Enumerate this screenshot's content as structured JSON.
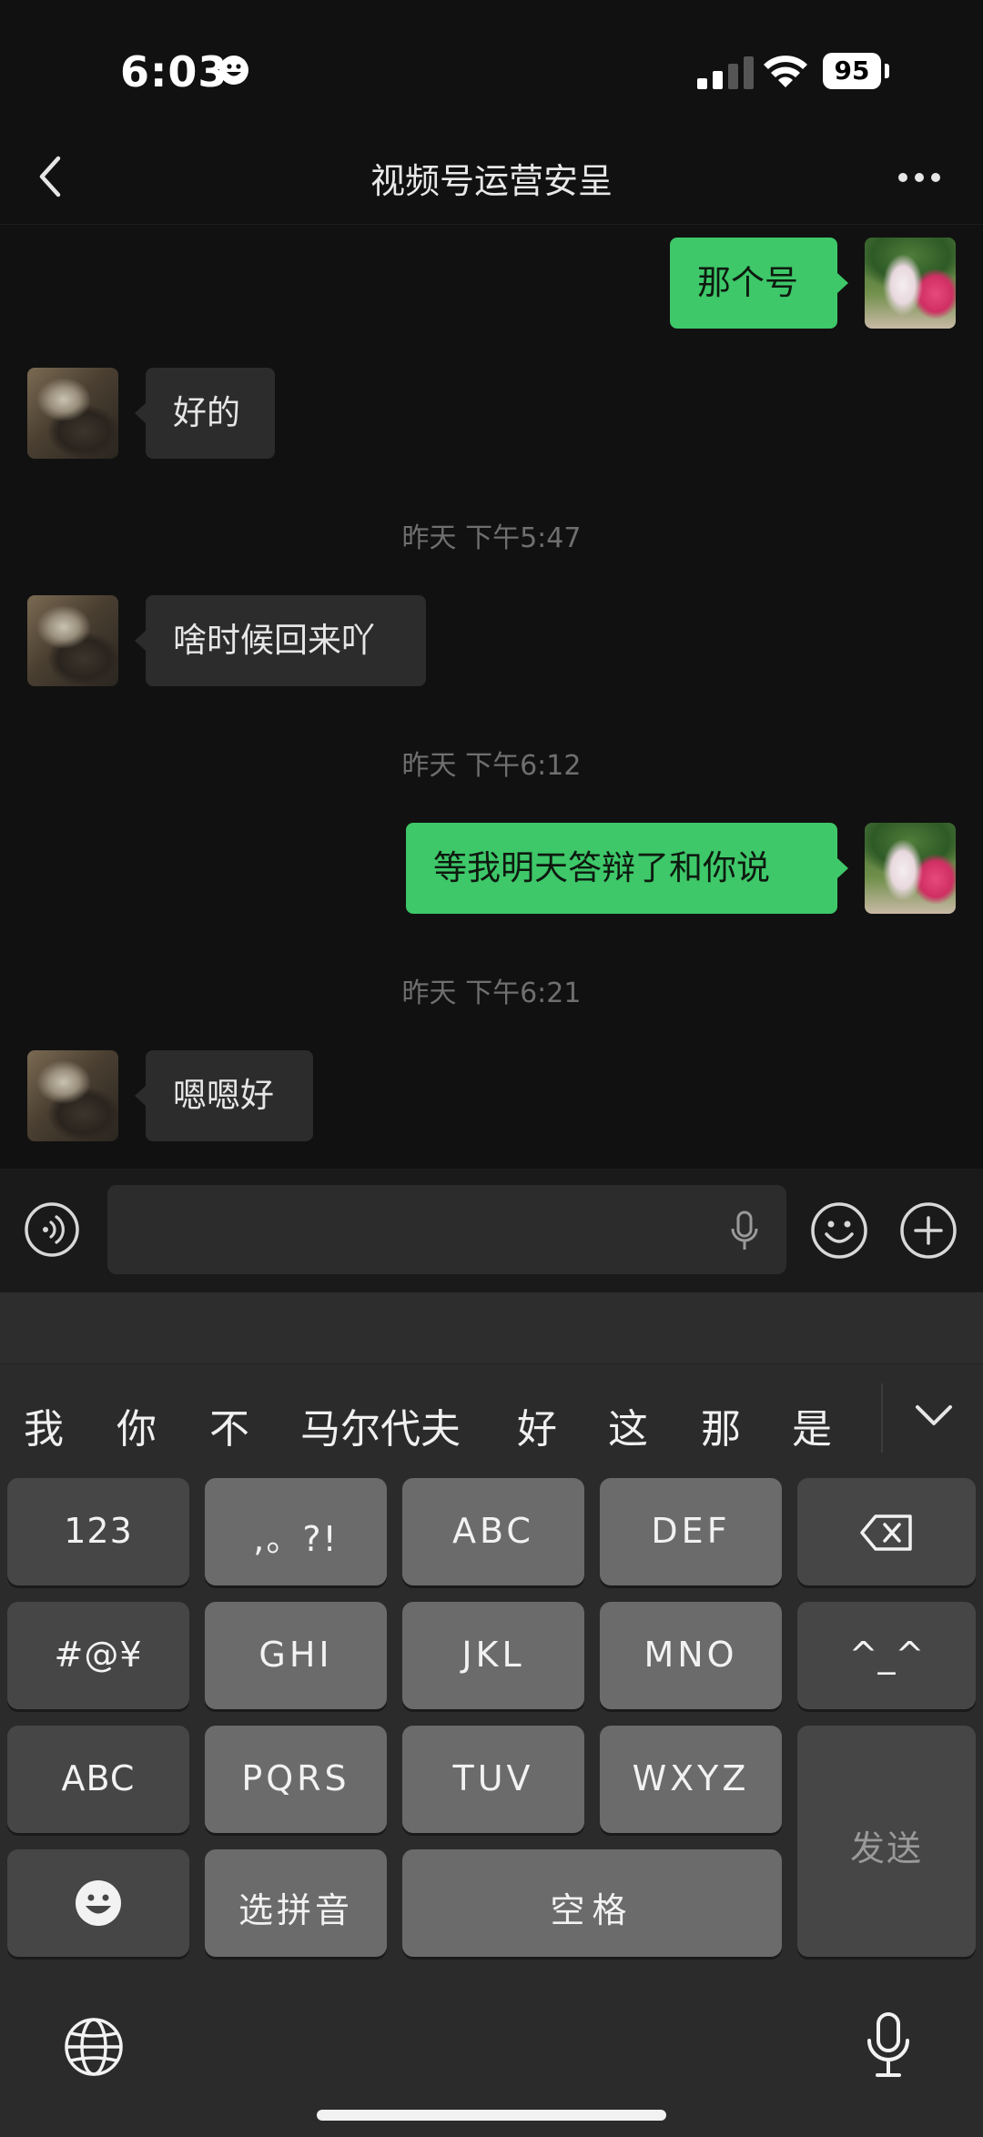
{
  "status_bar": {
    "time": "6:03",
    "battery": "95"
  },
  "header": {
    "title": "视频号运营安呈"
  },
  "messages": [
    {
      "dir": "out",
      "text": "那个号"
    },
    {
      "dir": "in",
      "text": "好的"
    },
    {
      "type": "time",
      "text": "昨天 下午5:47"
    },
    {
      "dir": "in",
      "text": "啥时候回来吖"
    },
    {
      "type": "time",
      "text": "昨天 下午6:12"
    },
    {
      "dir": "out",
      "text": "等我明天答辩了和你说"
    },
    {
      "type": "time",
      "text": "昨天 下午6:21"
    },
    {
      "dir": "in",
      "text": "嗯嗯好"
    }
  ],
  "input": {
    "value": "",
    "placeholder": ""
  },
  "keyboard": {
    "candidates": [
      "我",
      "你",
      "不",
      "马尔代夫",
      "好",
      "这",
      "那",
      "是"
    ],
    "keys": {
      "num": "123",
      "punct": ",。?!",
      "abc1": "ABC",
      "def": "DEF",
      "sym": "#@¥",
      "ghi": "GHI",
      "jkl": "JKL",
      "mno": "MNO",
      "face": "^_^",
      "abc2": "ABC",
      "pqrs": "PQRS",
      "tuv": "TUV",
      "wxyz": "WXYZ",
      "send": "发送",
      "pinyin": "选拼音",
      "space": "空格"
    }
  },
  "colors": {
    "background": "#111111",
    "bubble_in": "#2c2c2c",
    "bubble_out": "#3ec869",
    "timestamp": "#6f6f6f"
  },
  "icons": [
    "back-arrow-icon",
    "more-dots-icon",
    "voice-icon",
    "microphone-icon",
    "emoji-icon",
    "plus-icon",
    "chevron-down-icon",
    "backspace-icon",
    "globe-icon",
    "smiley-icon"
  ]
}
